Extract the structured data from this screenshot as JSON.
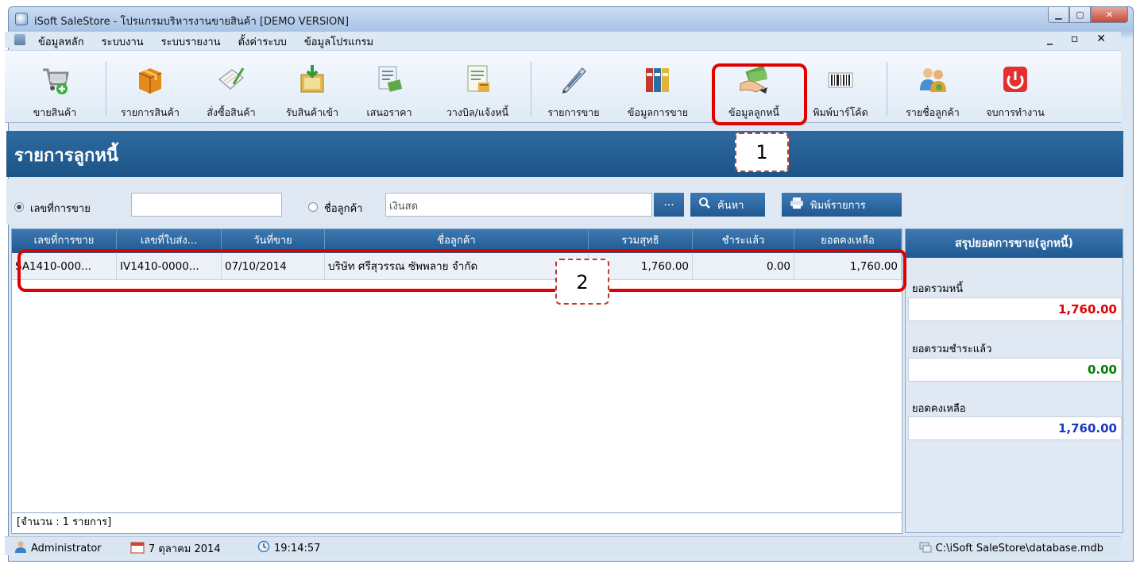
{
  "window": {
    "title": "iSoft SaleStore - โปรแกรมบริหารงานขายสินค้า [DEMO VERSION]"
  },
  "menu": {
    "items": [
      "ข้อมูลหลัก",
      "ระบบงาน",
      "ระบบรายงาน",
      "ตั้งค่าระบบ",
      "ข้อมูลโปรแกรม"
    ],
    "mdi_controls": "_ ▫ ×"
  },
  "toolbar": {
    "buttons": [
      {
        "label": "ขายสินค้า",
        "icon": "shopping-cart-icon"
      },
      {
        "label": "รายการสินค้า",
        "icon": "product-box-icon"
      },
      {
        "label": "สั่งซื้อสินค้า",
        "icon": "order-document-icon"
      },
      {
        "label": "รับสินค้าเข้า",
        "icon": "receive-goods-icon"
      },
      {
        "label": "เสนอราคา",
        "icon": "quotation-icon"
      },
      {
        "label": "วางบิล/แจ้งหนี้",
        "icon": "invoice-icon"
      },
      {
        "label": "รายการขาย",
        "icon": "pen-icon"
      },
      {
        "label": "ข้อมูลการขาย",
        "icon": "binders-icon"
      },
      {
        "label": "ข้อมูลลูกหนี้",
        "icon": "money-hand-icon"
      },
      {
        "label": "พิมพ์บาร์โค้ด",
        "icon": "barcode-icon"
      },
      {
        "label": "รายชื่อลูกค้า",
        "icon": "customers-icon"
      },
      {
        "label": "จบการทำงาน",
        "icon": "power-icon"
      }
    ]
  },
  "page": {
    "title": "รายการลูกหนี้"
  },
  "search": {
    "by_sale_no_label": "เลขที่การขาย",
    "sale_no_value": "",
    "by_customer_label": "ชื่อลูกค้า",
    "customer_value": "เงินสด",
    "browse_label": "...",
    "search_label": "ค้นหา",
    "print_label": "พิมพ์รายการ"
  },
  "grid": {
    "columns": [
      "เลขที่การขาย",
      "เลขที่ใบส่ง...",
      "วันที่ขาย",
      "ชื่อลูกค้า",
      "รวมสุทธิ",
      "ชำระแล้ว",
      "ยอดคงเหลือ"
    ],
    "rows": [
      [
        "SA1410-000...",
        "IV1410-0000...",
        "07/10/2014",
        "บริษัท ศรีสุวรรณ ซัพพลาย จำกัด",
        "1,760.00",
        "0.00",
        "1,760.00"
      ]
    ],
    "count_text": "[จำนวน : 1 รายการ]"
  },
  "summary": {
    "title": "สรุปยอดการขาย(ลูกหนี้)",
    "total_debt_label": "ยอดรวมหนี้",
    "total_debt_value": "1,760.00",
    "total_paid_label": "ยอดรวมชำระแล้ว",
    "total_paid_value": "0.00",
    "balance_label": "ยอดคงเหลือ",
    "balance_value": "1,760.00",
    "colors": {
      "debt": "#e00000",
      "paid": "#008000",
      "balance": "#1a35c8"
    }
  },
  "status": {
    "user": "Administrator",
    "date": "7 ตุลาคม 2014",
    "time": "19:14:57",
    "db_path": "C:\\iSoft SaleStore\\database.mdb"
  },
  "annotations": {
    "callout_1": "1",
    "callout_2": "2"
  }
}
